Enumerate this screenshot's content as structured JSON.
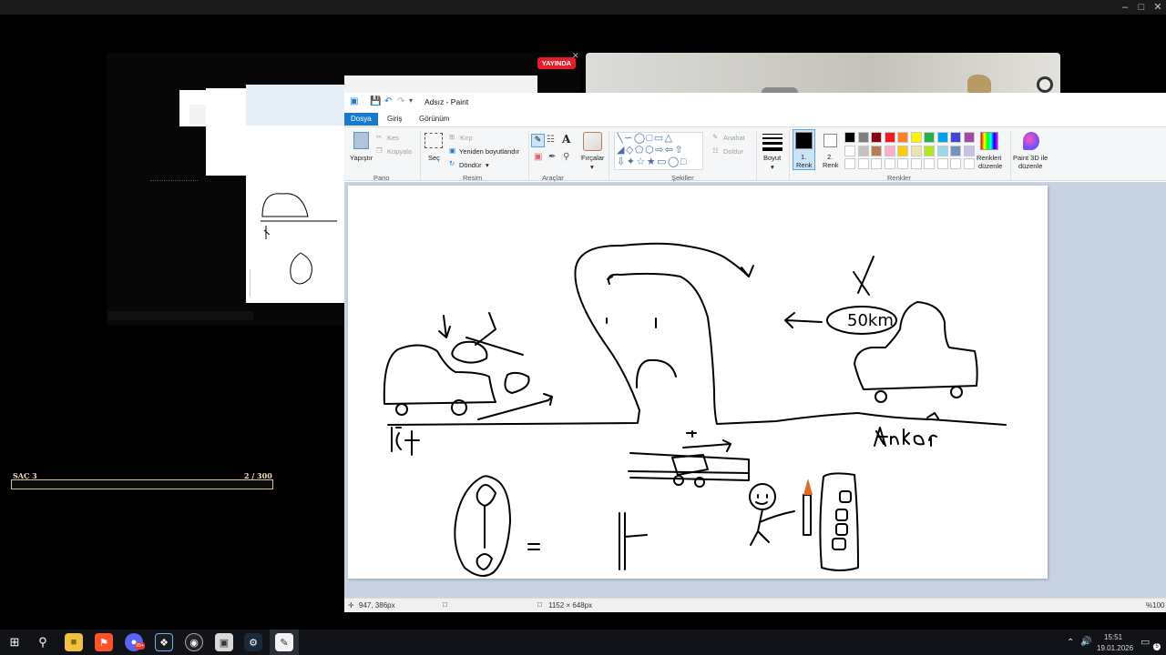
{
  "stream": {
    "live_badge": "YAYINDA",
    "hud_label": "SAÇ 3",
    "hud_counter": "2 / 300"
  },
  "paint": {
    "title": "Adsız - Paint",
    "tabs": {
      "file": "Dosya",
      "home": "Giriş",
      "view": "Görünüm"
    },
    "clipboard": {
      "paste": "Yapıştır",
      "cut": "Kes",
      "copy": "Kopyala",
      "group": "Pano"
    },
    "image": {
      "select": "Seç",
      "crop": "Kırp",
      "resize": "Yeniden boyutlandır",
      "rotate": "Döndür",
      "group": "Resim"
    },
    "tools": {
      "group": "Araçlar"
    },
    "brushes": {
      "label": "Fırçalar"
    },
    "shapes": {
      "outline": "Anahat",
      "fill": "Doldur",
      "group": "Şekiller"
    },
    "size": {
      "label": "Boyut"
    },
    "color1": {
      "line1": "1.",
      "line2": "Renk"
    },
    "color2": {
      "line1": "2.",
      "line2": "Renk"
    },
    "colors": {
      "group": "Renkler",
      "edit_line1": "Renkleri",
      "edit_line2": "düzenle",
      "palette_row1": [
        "#000000",
        "#7f7f7f",
        "#880015",
        "#ed1c24",
        "#ff7f27",
        "#fff200",
        "#22b14c",
        "#00a2e8",
        "#3f48cc",
        "#a349a4"
      ],
      "palette_row2": [
        "#ffffff",
        "#c3c3c3",
        "#b97a57",
        "#ffaec9",
        "#ffc90e",
        "#efe4b0",
        "#b5e61d",
        "#99d9ea",
        "#7092be",
        "#c8bfe7"
      ]
    },
    "paint3d": {
      "line1": "Paint 3D ile",
      "line2": "düzenle"
    },
    "canvas_text": {
      "ist": "İst",
      "ankara": "Ankara",
      "speed": "50km"
    },
    "status": {
      "cursor_pos": "947, 386px",
      "canvas_size": "1152 × 648px",
      "zoom": "%100"
    }
  },
  "taskbar": {
    "time": "15:51",
    "date": "19.01.2026",
    "notif_count": "5",
    "badge": "99+"
  }
}
